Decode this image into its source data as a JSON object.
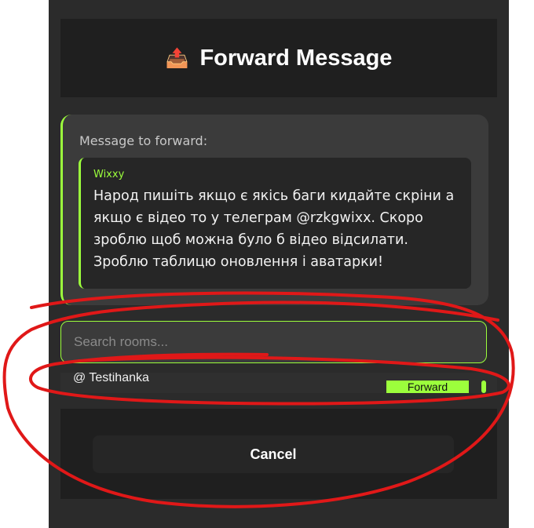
{
  "dialog": {
    "title": "Forward Message",
    "title_icon": "outbox-tray-icon"
  },
  "preview": {
    "label": "Message to forward:",
    "sender": "Wixxy",
    "text": "Народ пишіть якщо є якісь баги кидайте скріни а якщо є відео то у телеграм @rzkgwixx. Скоро зроблю щоб можна було б відео відсилати. Зроблю таблицю оновлення і аватарки!"
  },
  "search": {
    "placeholder": "Search rooms..."
  },
  "rooms": [
    {
      "name": "@ Testihanka",
      "action_label": "Forward"
    }
  ],
  "footer": {
    "cancel_label": "Cancel"
  },
  "colors": {
    "accent": "#9cff3c",
    "annotation": "#e01818",
    "modal_bg": "#2b2b2b"
  }
}
